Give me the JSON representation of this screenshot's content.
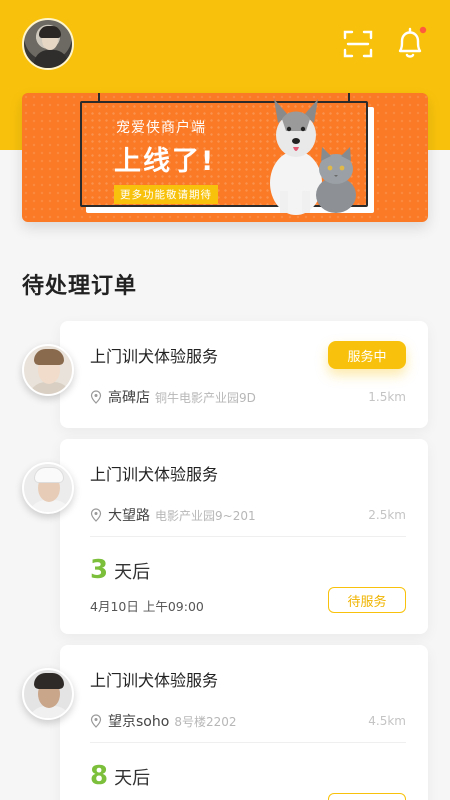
{
  "header": {
    "avatar": "user-avatar",
    "icons": {
      "scan": "scan-icon",
      "bell": "bell-icon"
    },
    "accent_color": "#f8c20c",
    "notification_dot_color": "#ff5a3c"
  },
  "banner": {
    "subtitle": "宠爱侠商户端",
    "headline": "上线了!",
    "tag": "更多功能敬请期待",
    "background_color": "#fa7a26"
  },
  "section": {
    "title": "待处理订单"
  },
  "orders": [
    {
      "service": "上门训犬体验服务",
      "location_name": "高碑店",
      "address": "铜牛电影产业园9D",
      "distance": "1.5km",
      "status": "服务中"
    },
    {
      "service": "上门训犬体验服务",
      "location_name": "大望路",
      "address": "电影产业园9~201",
      "distance": "2.5km",
      "days_num": "3",
      "days_unit": "天后",
      "appointment": "4月10日 上午09:00",
      "status": "待服务"
    },
    {
      "service": "上门训犬体验服务",
      "location_name": "望京soho",
      "address": "8号楼2202",
      "distance": "4.5km",
      "days_num": "8",
      "days_unit": "天后"
    }
  ]
}
